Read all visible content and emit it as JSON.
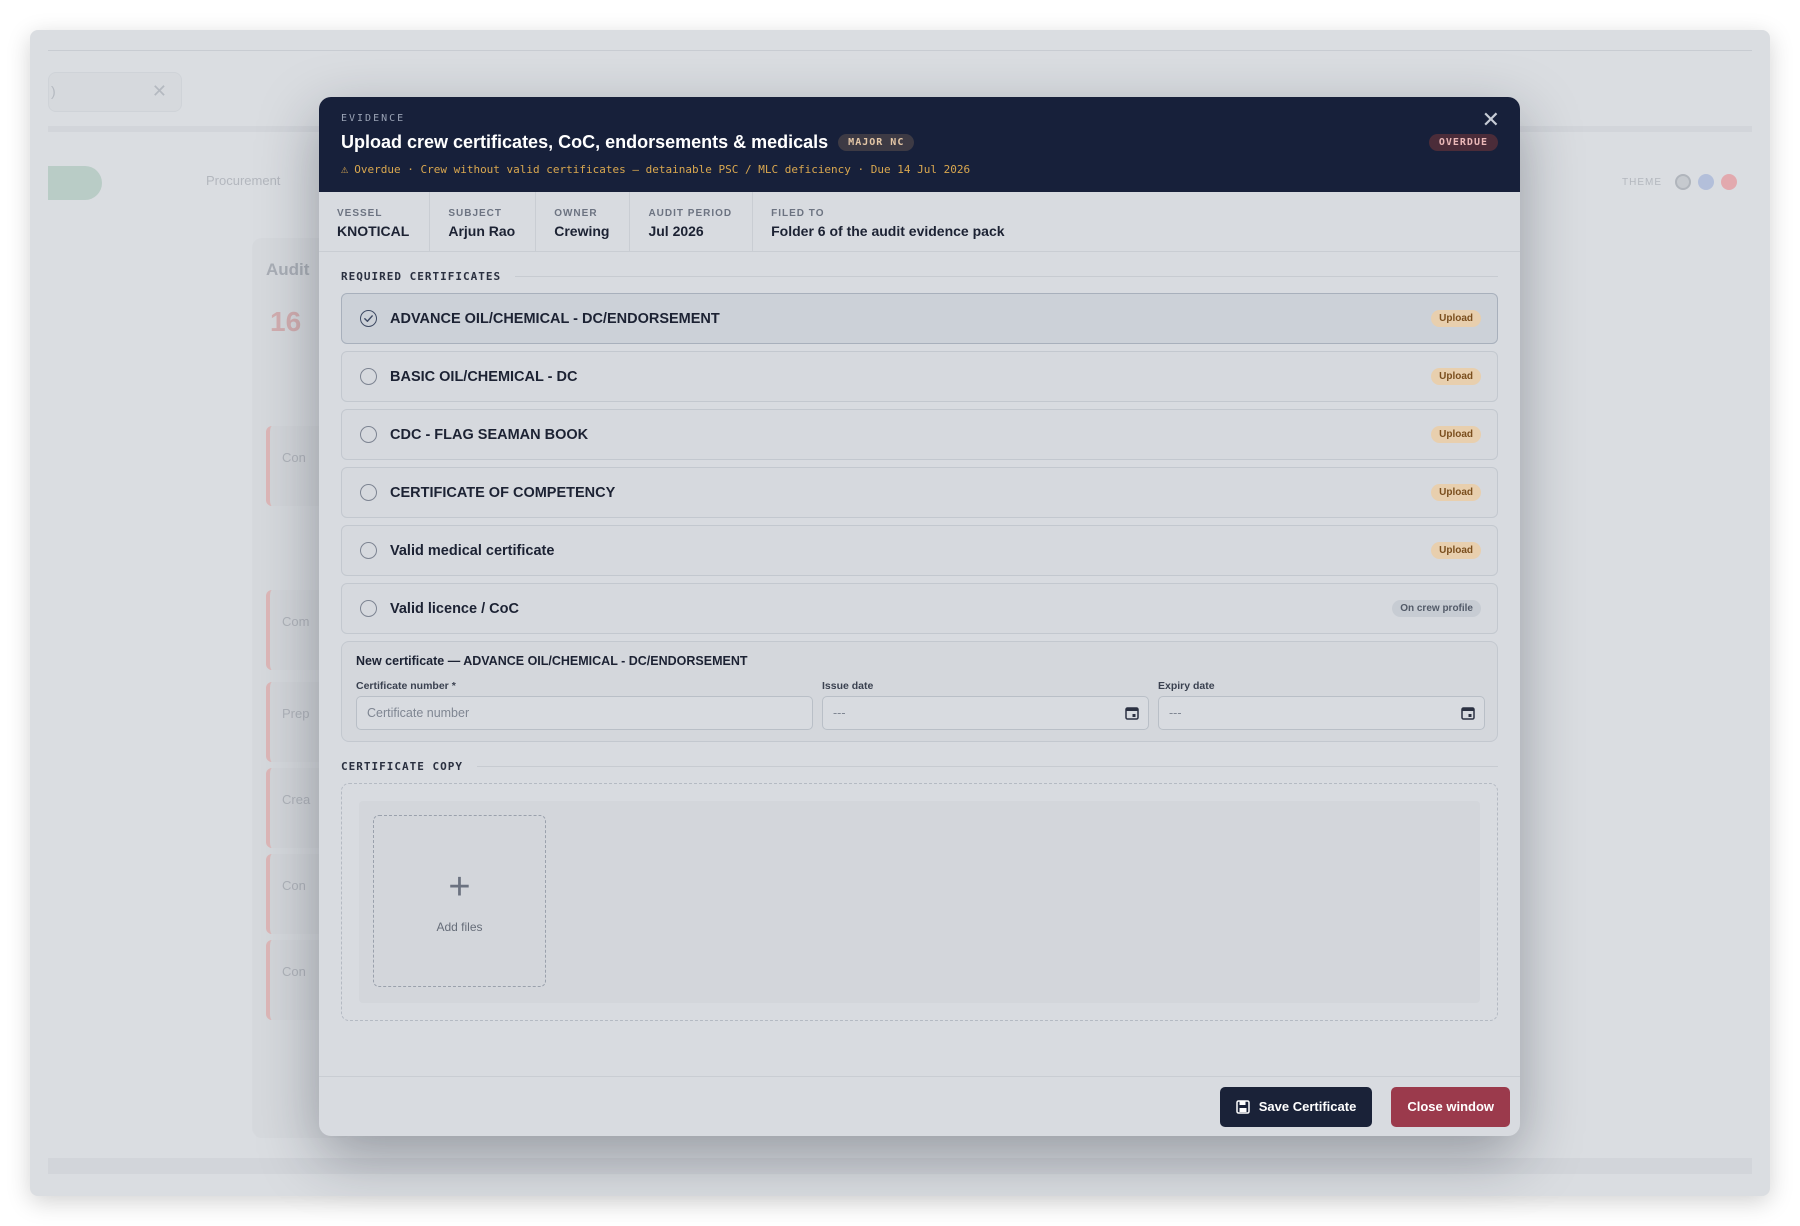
{
  "background": {
    "search_text": ")",
    "tab_label": "Procurement",
    "theme_label": "THEME",
    "theme_colors": [
      "#c6cacf",
      "#b3bfda",
      "#e2a9ae"
    ],
    "card_title": "Audit",
    "overdue_count": "16"
  },
  "modal": {
    "eyebrow": "EVIDENCE",
    "title": "Upload crew certificates, CoC, endorsements & medicals",
    "severity_badge": "MAJOR NC",
    "status_badge": "OVERDUE",
    "warning_text": "Overdue · Crew without valid certificates — detainable PSC / MLC deficiency · Due 14 Jul 2026",
    "meta": [
      {
        "label": "VESSEL",
        "value": "KNOTICAL"
      },
      {
        "label": "SUBJECT",
        "value": "Arjun Rao"
      },
      {
        "label": "OWNER",
        "value": "Crewing"
      },
      {
        "label": "AUDIT PERIOD",
        "value": "Jul 2026"
      },
      {
        "label": "FILED TO",
        "value": "Folder 6 of the audit evidence pack"
      }
    ],
    "required_section_title": "REQUIRED CERTIFICATES",
    "certificates": [
      {
        "name": "ADVANCE OIL/CHEMICAL - DC/ENDORSEMENT",
        "tag": "Upload",
        "selected": true
      },
      {
        "name": "BASIC OIL/CHEMICAL - DC",
        "tag": "Upload",
        "selected": false
      },
      {
        "name": "CDC - FLAG SEAMAN BOOK",
        "tag": "Upload",
        "selected": false
      },
      {
        "name": "CERTIFICATE OF COMPETENCY",
        "tag": "Upload",
        "selected": false
      },
      {
        "name": "Valid medical certificate",
        "tag": "Upload",
        "selected": false
      },
      {
        "name": "Valid licence / CoC",
        "tag": "On crew profile",
        "selected": false
      }
    ],
    "new_cert": {
      "title": "New certificate — ADVANCE OIL/CHEMICAL - DC/ENDORSEMENT",
      "number_label": "Certificate number *",
      "number_placeholder": "Certificate number",
      "issue_label": "Issue date",
      "issue_value": "---",
      "expiry_label": "Expiry date",
      "expiry_value": "---"
    },
    "copy_section_title": "CERTIFICATE COPY",
    "add_files_label": "Add files",
    "save_button": "Save Certificate",
    "close_button": "Close window"
  },
  "colors": {
    "header_bg": "#17203a",
    "accent_warning": "#d9a74f",
    "save_bg": "#1a2238",
    "close_bg": "#9b3a4c",
    "upload_tag_bg": "#e8cfae"
  }
}
